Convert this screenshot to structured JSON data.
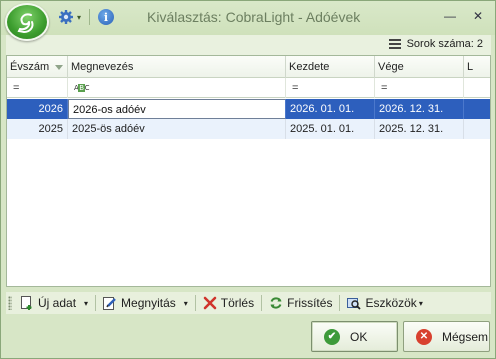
{
  "window": {
    "title": "Kiválasztás: CobraLight - Adóévek",
    "icons": {
      "app": "app-orb-icon",
      "settings": "gear-icon",
      "info": "info-icon",
      "minimize": "minimize-icon",
      "close": "close-icon"
    },
    "buttons": {
      "minimize": "—",
      "close": "✕"
    }
  },
  "status": {
    "row_count_label": "Sorok száma: 2"
  },
  "grid": {
    "columns": [
      {
        "label": "Évszám",
        "sorted": true
      },
      {
        "label": "Megnevezés"
      },
      {
        "label": "Kezdete"
      },
      {
        "label": "Vége"
      },
      {
        "label": "L"
      }
    ],
    "filter_row": {
      "evszam_operator": "=",
      "kezdete_operator": "=",
      "vege_operator": "=",
      "megnevezes_icon": "text-filter-icon",
      "megnevezes_icon_text_a": "A",
      "megnevezes_icon_text_b": "B",
      "megnevezes_icon_text_c": "C"
    },
    "rows": [
      {
        "evszam": "2026",
        "megnevezes": "2026-os adóév",
        "kezdete": "2026. 01. 01.",
        "vege": "2026. 12. 31.",
        "selected": true
      },
      {
        "evszam": "2025",
        "megnevezes": "2025-ös adóév",
        "kezdete": "2025. 01. 01.",
        "vege": "2025. 12. 31.",
        "selected": false
      }
    ],
    "colors": {
      "selected_row": "#2d5fbd",
      "alt_row": "#eaf2fc"
    }
  },
  "toolbar": {
    "new_label": "Új adat",
    "open_label": "Megnyitás",
    "delete_label": "Törlés",
    "refresh_label": "Frissítés",
    "tools_label": "Eszközök",
    "dropdown_glyph": "▾",
    "icons": {
      "new": "new-document-icon",
      "open": "edit-document-icon",
      "delete": "delete-x-icon",
      "refresh": "refresh-icon",
      "tools": "tools-icon"
    }
  },
  "dialog_buttons": {
    "ok_label": "OK",
    "cancel_label": "Mégsem",
    "icons": {
      "ok": "check-icon",
      "cancel": "cancel-icon"
    },
    "glyphs": {
      "ok": "✔",
      "cancel": "✕"
    }
  },
  "theme": {
    "accent": "#d7e6c6",
    "title_text": "#6c7f60"
  }
}
